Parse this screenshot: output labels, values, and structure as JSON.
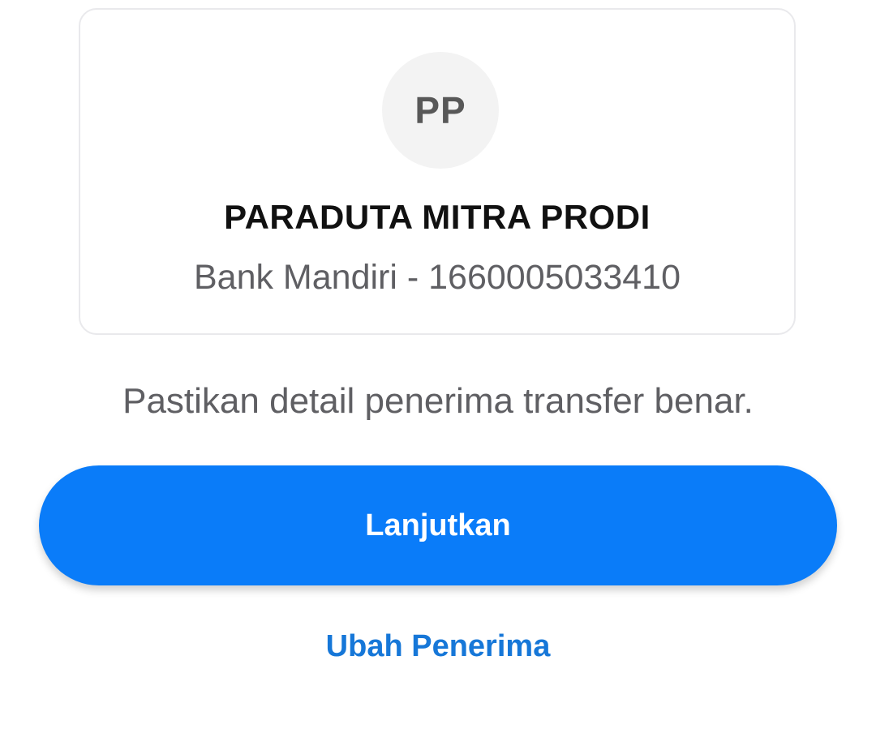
{
  "recipient": {
    "initials": "PP",
    "name": "PARADUTA MITRA PRODI",
    "account": "Bank Mandiri - 1660005033410"
  },
  "confirmation": {
    "note": "Pastikan detail penerima transfer benar."
  },
  "actions": {
    "continue_label": "Lanjutkan",
    "change_recipient_label": "Ubah Penerima"
  },
  "colors": {
    "primary_button": "#0a7cf9",
    "link": "#1677d8",
    "avatar_background": "#f3f3f3"
  }
}
